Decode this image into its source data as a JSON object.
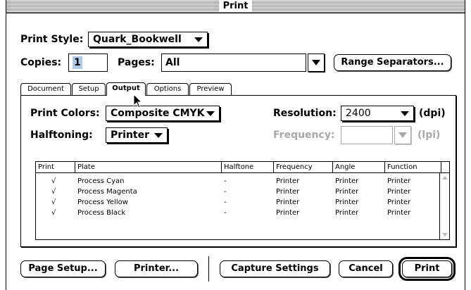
{
  "window": {
    "title": "Print"
  },
  "print_style": {
    "label": "Print Style:",
    "value": "Quark_Bookwell"
  },
  "copies": {
    "label": "Copies:",
    "value": "1"
  },
  "pages": {
    "label": "Pages:",
    "value": "All"
  },
  "range_separators_label": "Range Separators...",
  "tabs": [
    {
      "label": "Document"
    },
    {
      "label": "Setup"
    },
    {
      "label": "Output",
      "active": true
    },
    {
      "label": "Options"
    },
    {
      "label": "Preview"
    }
  ],
  "output": {
    "print_colors": {
      "label": "Print Colors:",
      "value": "Composite CMYK"
    },
    "halftoning": {
      "label": "Halftoning:",
      "value": "Printer"
    },
    "resolution": {
      "label": "Resolution:",
      "value": "2400",
      "unit": "(dpi)"
    },
    "frequency": {
      "label": "Frequency:",
      "value": "",
      "unit": "(lpi)",
      "disabled": true
    }
  },
  "plates_table": {
    "headers": [
      "Print",
      "Plate",
      "Halftone",
      "Frequency",
      "Angle",
      "Function"
    ],
    "rows": [
      {
        "print": "√",
        "plate": "Process Cyan",
        "halftone": "-",
        "frequency": "Printer",
        "angle": "Printer",
        "function": "Printer"
      },
      {
        "print": "√",
        "plate": "Process Magenta",
        "halftone": "-",
        "frequency": "Printer",
        "angle": "Printer",
        "function": "Printer"
      },
      {
        "print": "√",
        "plate": "Process Yellow",
        "halftone": "-",
        "frequency": "Printer",
        "angle": "Printer",
        "function": "Printer"
      },
      {
        "print": "√",
        "plate": "Process Black",
        "halftone": "-",
        "frequency": "Printer",
        "angle": "Printer",
        "function": "Printer"
      }
    ]
  },
  "buttons": {
    "page_setup": "Page Setup...",
    "printer": "Printer...",
    "capture_settings": "Capture Settings",
    "cancel": "Cancel",
    "print": "Print"
  },
  "icons": {
    "cursor": "arrow-cursor-icon",
    "dropdown": "triangle-down-icon"
  }
}
